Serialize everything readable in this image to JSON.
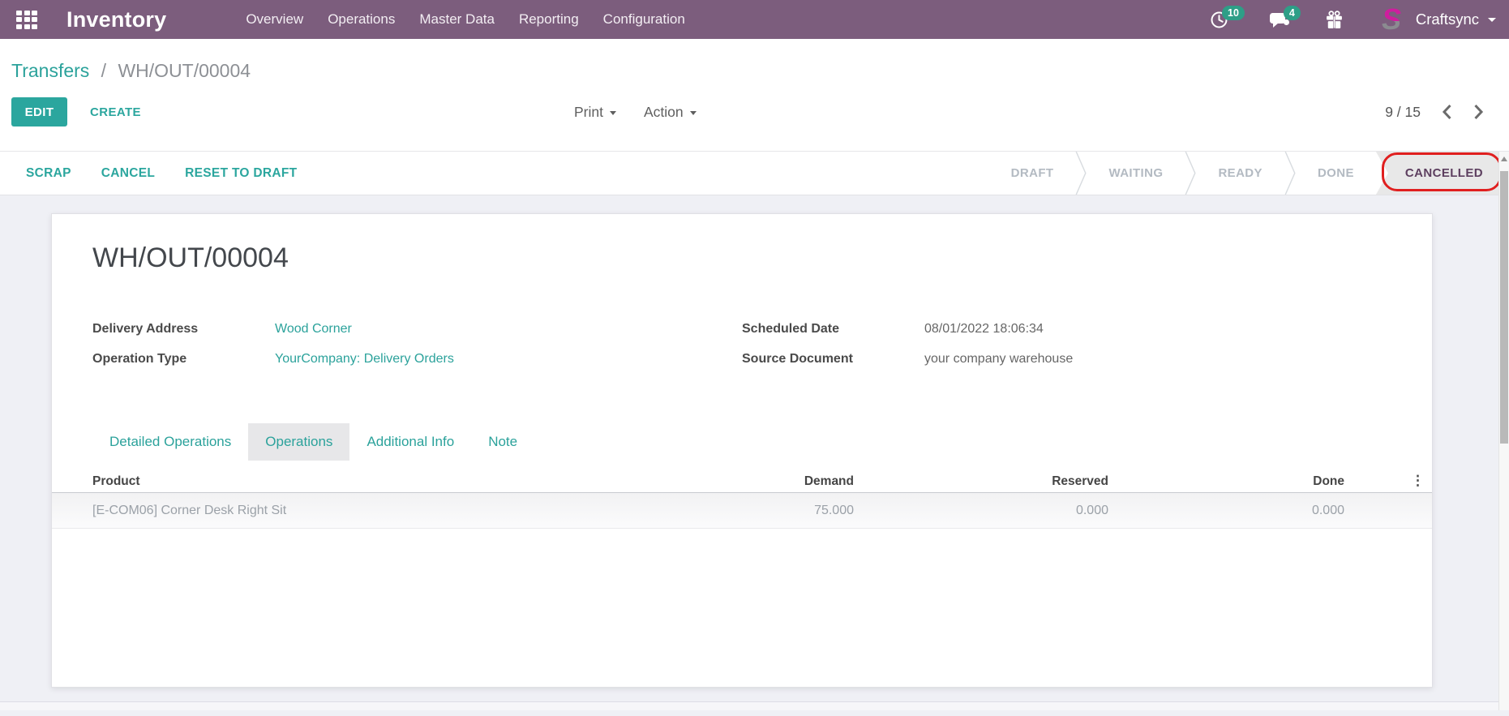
{
  "navbar": {
    "app_title": "Inventory",
    "menu_items": [
      "Overview",
      "Operations",
      "Master Data",
      "Reporting",
      "Configuration"
    ],
    "activities_count": "10",
    "messages_count": "4",
    "user_name": "Craftsync",
    "icons": [
      "apps-grid-icon",
      "clock-icon",
      "chat-icon",
      "gift-icon",
      "company-logo",
      "chevron-down-icon"
    ]
  },
  "breadcrumb": {
    "parent": "Transfers",
    "separator": "/",
    "current": "WH/OUT/00004"
  },
  "control_panel": {
    "edit_label": "EDIT",
    "create_label": "CREATE",
    "print_label": "Print",
    "action_label": "Action",
    "pager": "9 / 15"
  },
  "statusbar": {
    "buttons": [
      "SCRAP",
      "CANCEL",
      "RESET TO DRAFT"
    ],
    "states": [
      "DRAFT",
      "WAITING",
      "READY",
      "DONE",
      "CANCELLED"
    ],
    "active_state": "CANCELLED",
    "annotation": "red-ellipse-around-cancelled"
  },
  "form": {
    "title": "WH/OUT/00004",
    "fields_left": [
      {
        "label": "Delivery Address",
        "value": "Wood Corner"
      },
      {
        "label": "Operation Type",
        "value": "YourCompany: Delivery Orders"
      }
    ],
    "fields_right": [
      {
        "label": "Scheduled Date",
        "value": "08/01/2022 18:06:34"
      },
      {
        "label": "Source Document",
        "value": "your company warehouse"
      }
    ],
    "tabs": [
      "Detailed Operations",
      "Operations",
      "Additional Info",
      "Note"
    ],
    "active_tab": "Operations"
  },
  "table": {
    "columns": [
      "Product",
      "Demand",
      "Reserved",
      "Done"
    ],
    "options_icon": "vertical-dots-icon",
    "rows": [
      {
        "product": "[E-COM06] Corner Desk Right Sit",
        "demand": "75.000",
        "reserved": "0.000",
        "done": "0.000"
      }
    ]
  },
  "colors": {
    "navbar_bg": "#7c5d7d",
    "accent_teal": "#2ba69e",
    "badge_green": "#2e9e87",
    "cancelled_text": "#5d3f5f",
    "annotation_red": "#e01f1f",
    "page_bg": "#eff0f5",
    "muted_row_text": "#9ba1a8"
  }
}
